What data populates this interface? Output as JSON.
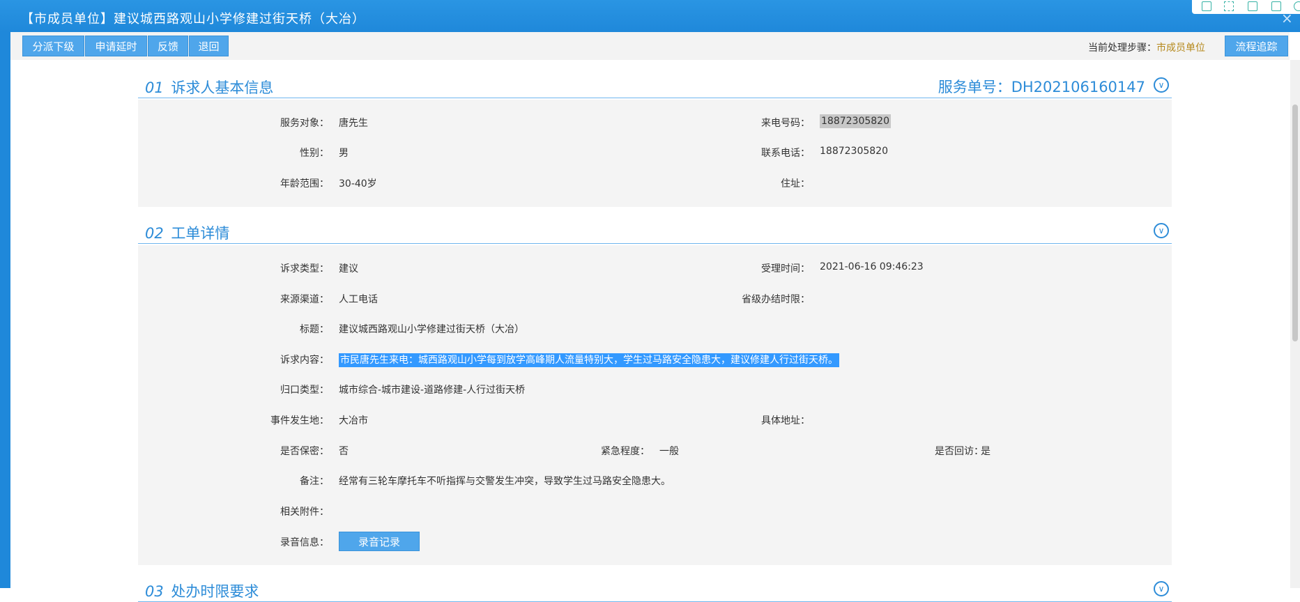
{
  "window": {
    "title": "【市成员单位】建议城西路观山小学修建过街天桥（大冶）",
    "close_glyph": "×"
  },
  "toolbar": {
    "buttons": [
      "分派下级",
      "申请延时",
      "反馈",
      "退回"
    ],
    "step_label": "当前处理步骤：",
    "step_value": "市成员单位",
    "trace_button": "流程追踪"
  },
  "section1": {
    "num": "01",
    "title": "诉求人基本信息",
    "service_no_label": "服务单号：",
    "service_no": "DH202106160147",
    "fields": {
      "service_target_label": "服务对象：",
      "service_target": "唐先生",
      "caller_phone_label": "来电号码：",
      "caller_phone": "18872305820",
      "gender_label": "性别：",
      "gender": "男",
      "contact_phone_label": "联系电话：",
      "contact_phone": "18872305820",
      "age_label": "年龄范围：",
      "age": "30-40岁",
      "address_label": "住址：",
      "address": ""
    }
  },
  "section2": {
    "num": "02",
    "title": "工单详情",
    "fields": {
      "type_label": "诉求类型：",
      "type": "建议",
      "accept_time_label": "受理时间：",
      "accept_time": "2021-06-16 09:46:23",
      "channel_label": "来源渠道：",
      "channel": "人工电话",
      "deadline_label": "省级办结时限：",
      "deadline": "",
      "subject_label": "标题：",
      "subject": "建议城西路观山小学修建过街天桥（大冶）",
      "content_label": "诉求内容：",
      "content": "市民唐先生来电：城西路观山小学每到放学高峰期人流量特别大，学生过马路安全隐患大，建议修建人行过街天桥。",
      "category_label": "归口类型：",
      "category": "城市综合-城市建设-道路修建-人行过街天桥",
      "location_label": "事件发生地：",
      "location": "大冶市",
      "detail_address_label": "具体地址：",
      "detail_address": "",
      "secret_label": "是否保密：",
      "secret": "否",
      "urgency_label": "紧急程度：",
      "urgency": "一般",
      "callback_label": "是否回访：",
      "callback": "是",
      "remark_label": "备注：",
      "remark": "经常有三轮车摩托车不听指挥与交警发生冲突，导致学生过马路安全隐患大。",
      "attachment_label": "相关附件：",
      "attachment": "",
      "recording_label": "录音信息：",
      "recording_button": "录音记录"
    }
  },
  "section3": {
    "num": "03",
    "title": "处办时限要求"
  },
  "colors": {
    "brand_blue": "#1f88da",
    "accent_text": "#2d8cd8",
    "button_blue": "#4fa6eb",
    "highlight": "#3399ff",
    "step_value_color": "#b5881b"
  },
  "icons": [
    "mobile-icon",
    "fullscreen-icon",
    "save-icon",
    "export-icon",
    "settings-icon",
    "close-icon",
    "chevron-down-icon"
  ]
}
